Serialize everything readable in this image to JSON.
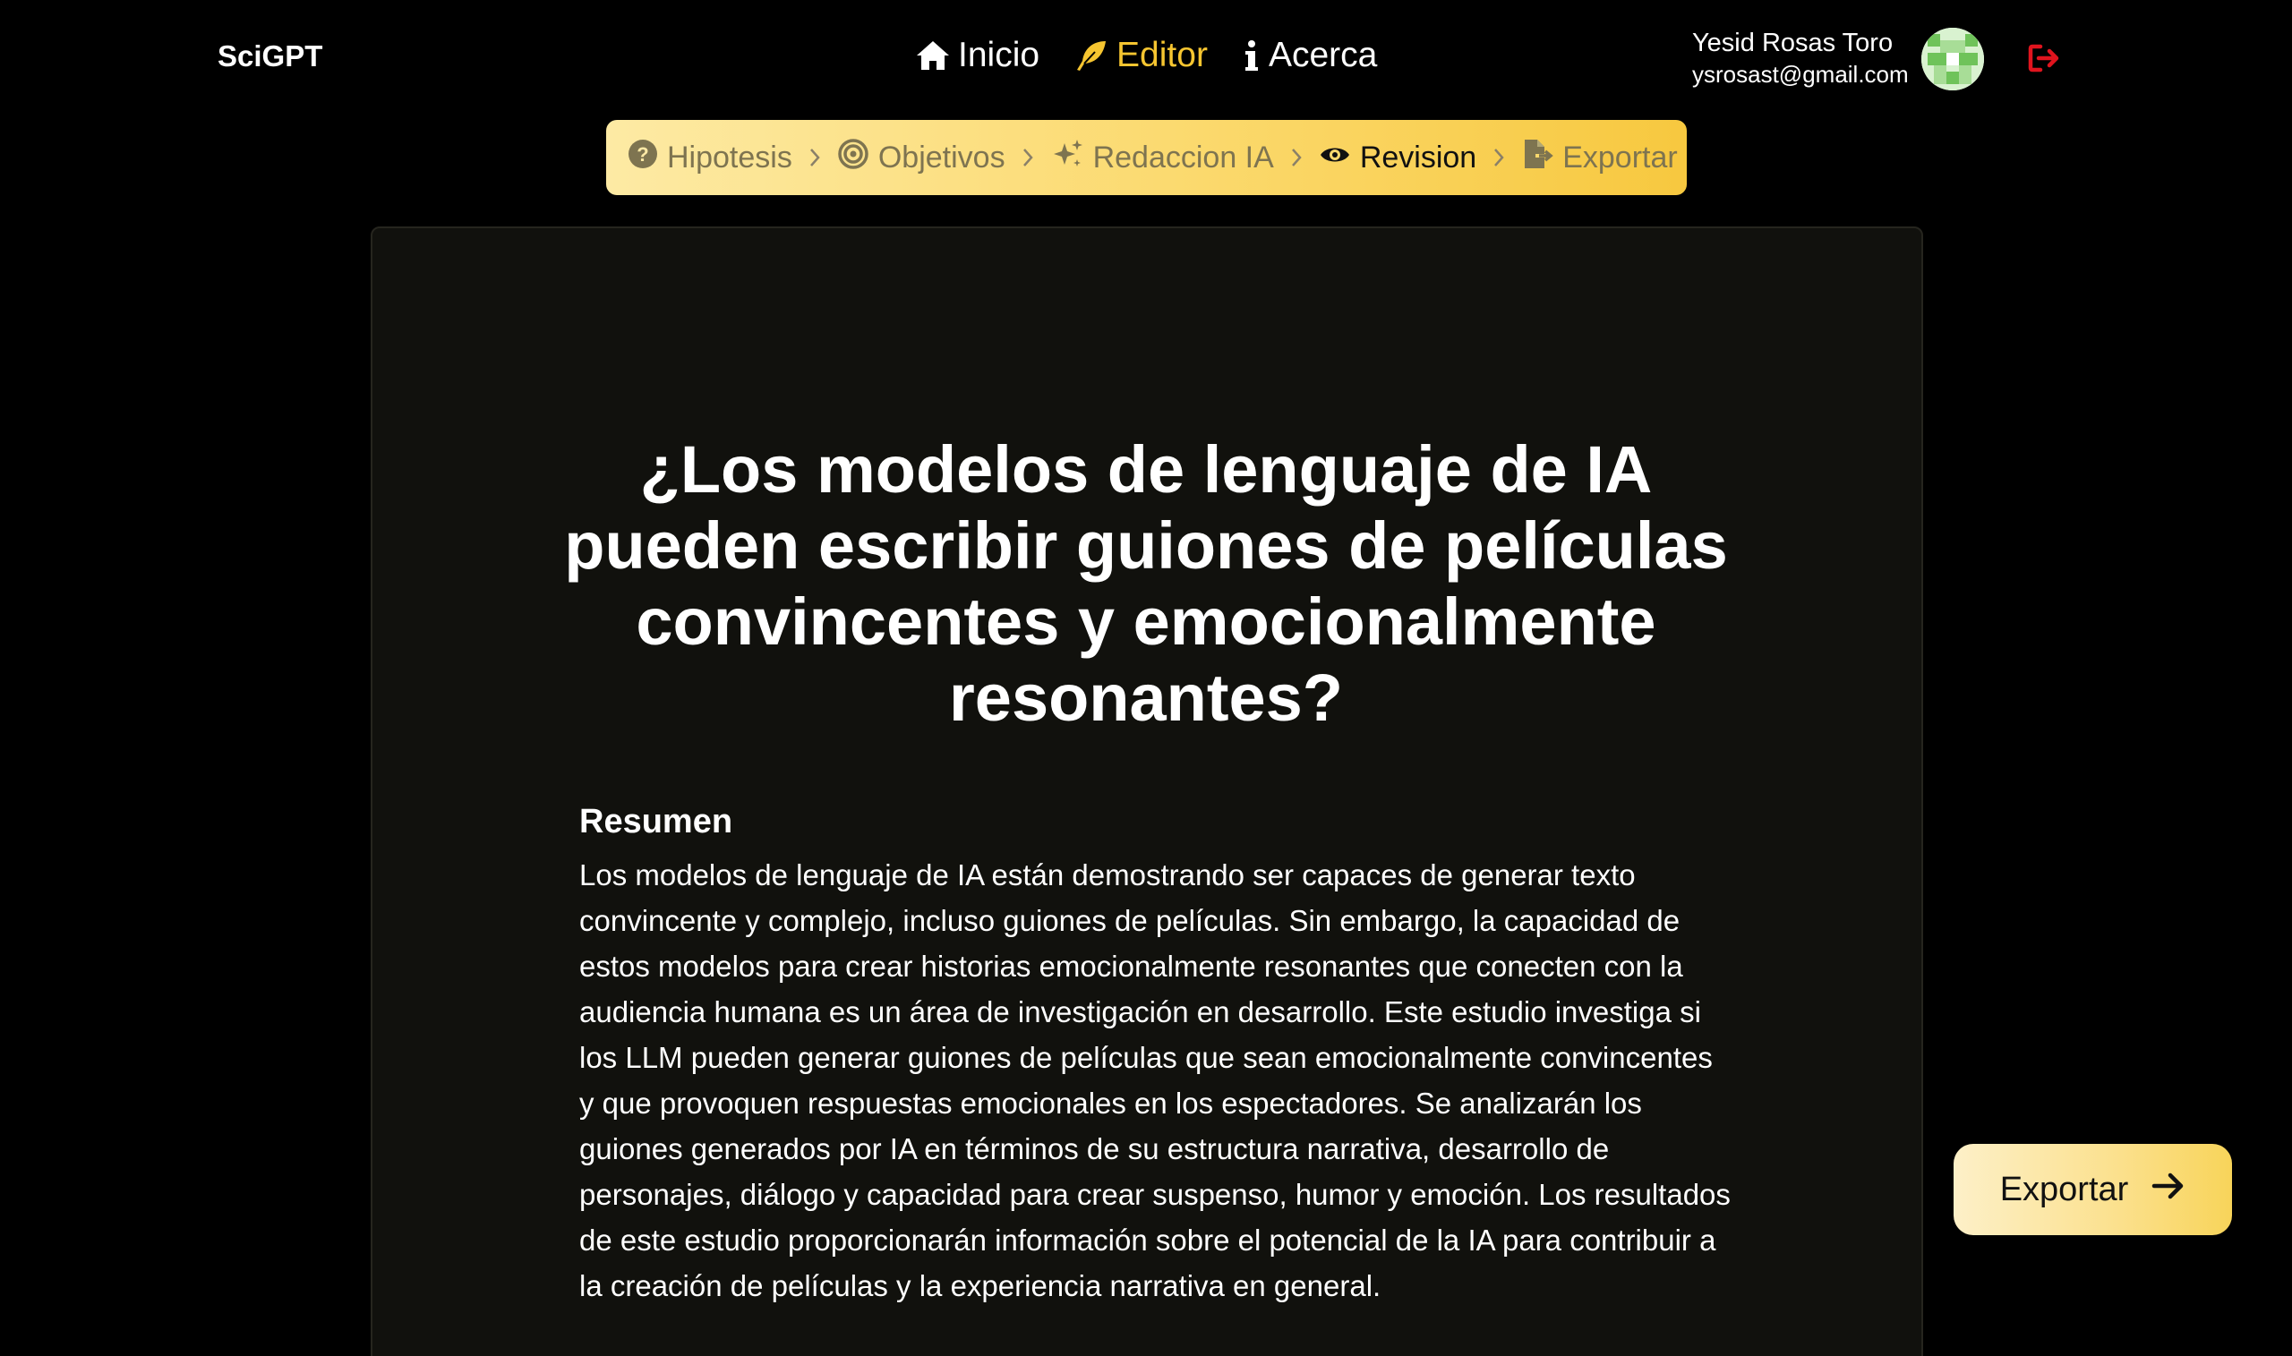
{
  "app": {
    "brand": "SciGPT"
  },
  "nav": {
    "items": [
      {
        "label": "Inicio",
        "icon": "home-icon"
      },
      {
        "label": "Editor",
        "icon": "feather-icon",
        "active": true
      },
      {
        "label": "Acerca",
        "icon": "info-icon"
      }
    ]
  },
  "user": {
    "name": "Yesid Rosas Toro",
    "email": "ysrosast@gmail.com",
    "logout_icon": "logout-icon"
  },
  "stepper": {
    "steps": [
      {
        "label": "Hipotesis",
        "icon": "question-circle-icon"
      },
      {
        "label": "Objetivos",
        "icon": "target-icon"
      },
      {
        "label": "Redaccion IA",
        "icon": "sparkles-icon"
      },
      {
        "label": "Revision",
        "icon": "eye-icon",
        "current": true
      },
      {
        "label": "Exportar",
        "icon": "file-export-icon"
      }
    ]
  },
  "document": {
    "title": "¿Los modelos de lenguaje de IA pueden escribir guiones de películas convincentes y emocionalmente resonantes?",
    "abstract_heading": "Resumen",
    "abstract_text": "Los modelos de lenguaje de IA están demostrando ser capaces de generar texto convincente y complejo, incluso guiones de películas. Sin embargo, la capacidad de estos modelos para crear historias emocionalmente resonantes que conecten con la audiencia humana es un área de investigación en desarrollo. Este estudio investiga si los LLM pueden generar guiones de películas que sean emocionalmente convincentes y que provoquen respuestas emocionales en los espectadores. Se analizarán los guiones generados por IA en términos de su estructura narrativa, desarrollo de personajes, diálogo y capacidad para crear suspenso, humor y emoción. Los resultados de este estudio proporcionarán información sobre el potencial de la IA para contribuir a la creación de películas y la experiencia narrativa en general."
  },
  "actions": {
    "export_label": "Exportar",
    "export_icon": "arrow-right-icon"
  },
  "colors": {
    "accent": "#f6c530",
    "danger": "#e0141e",
    "card_bg": "#11110d"
  }
}
